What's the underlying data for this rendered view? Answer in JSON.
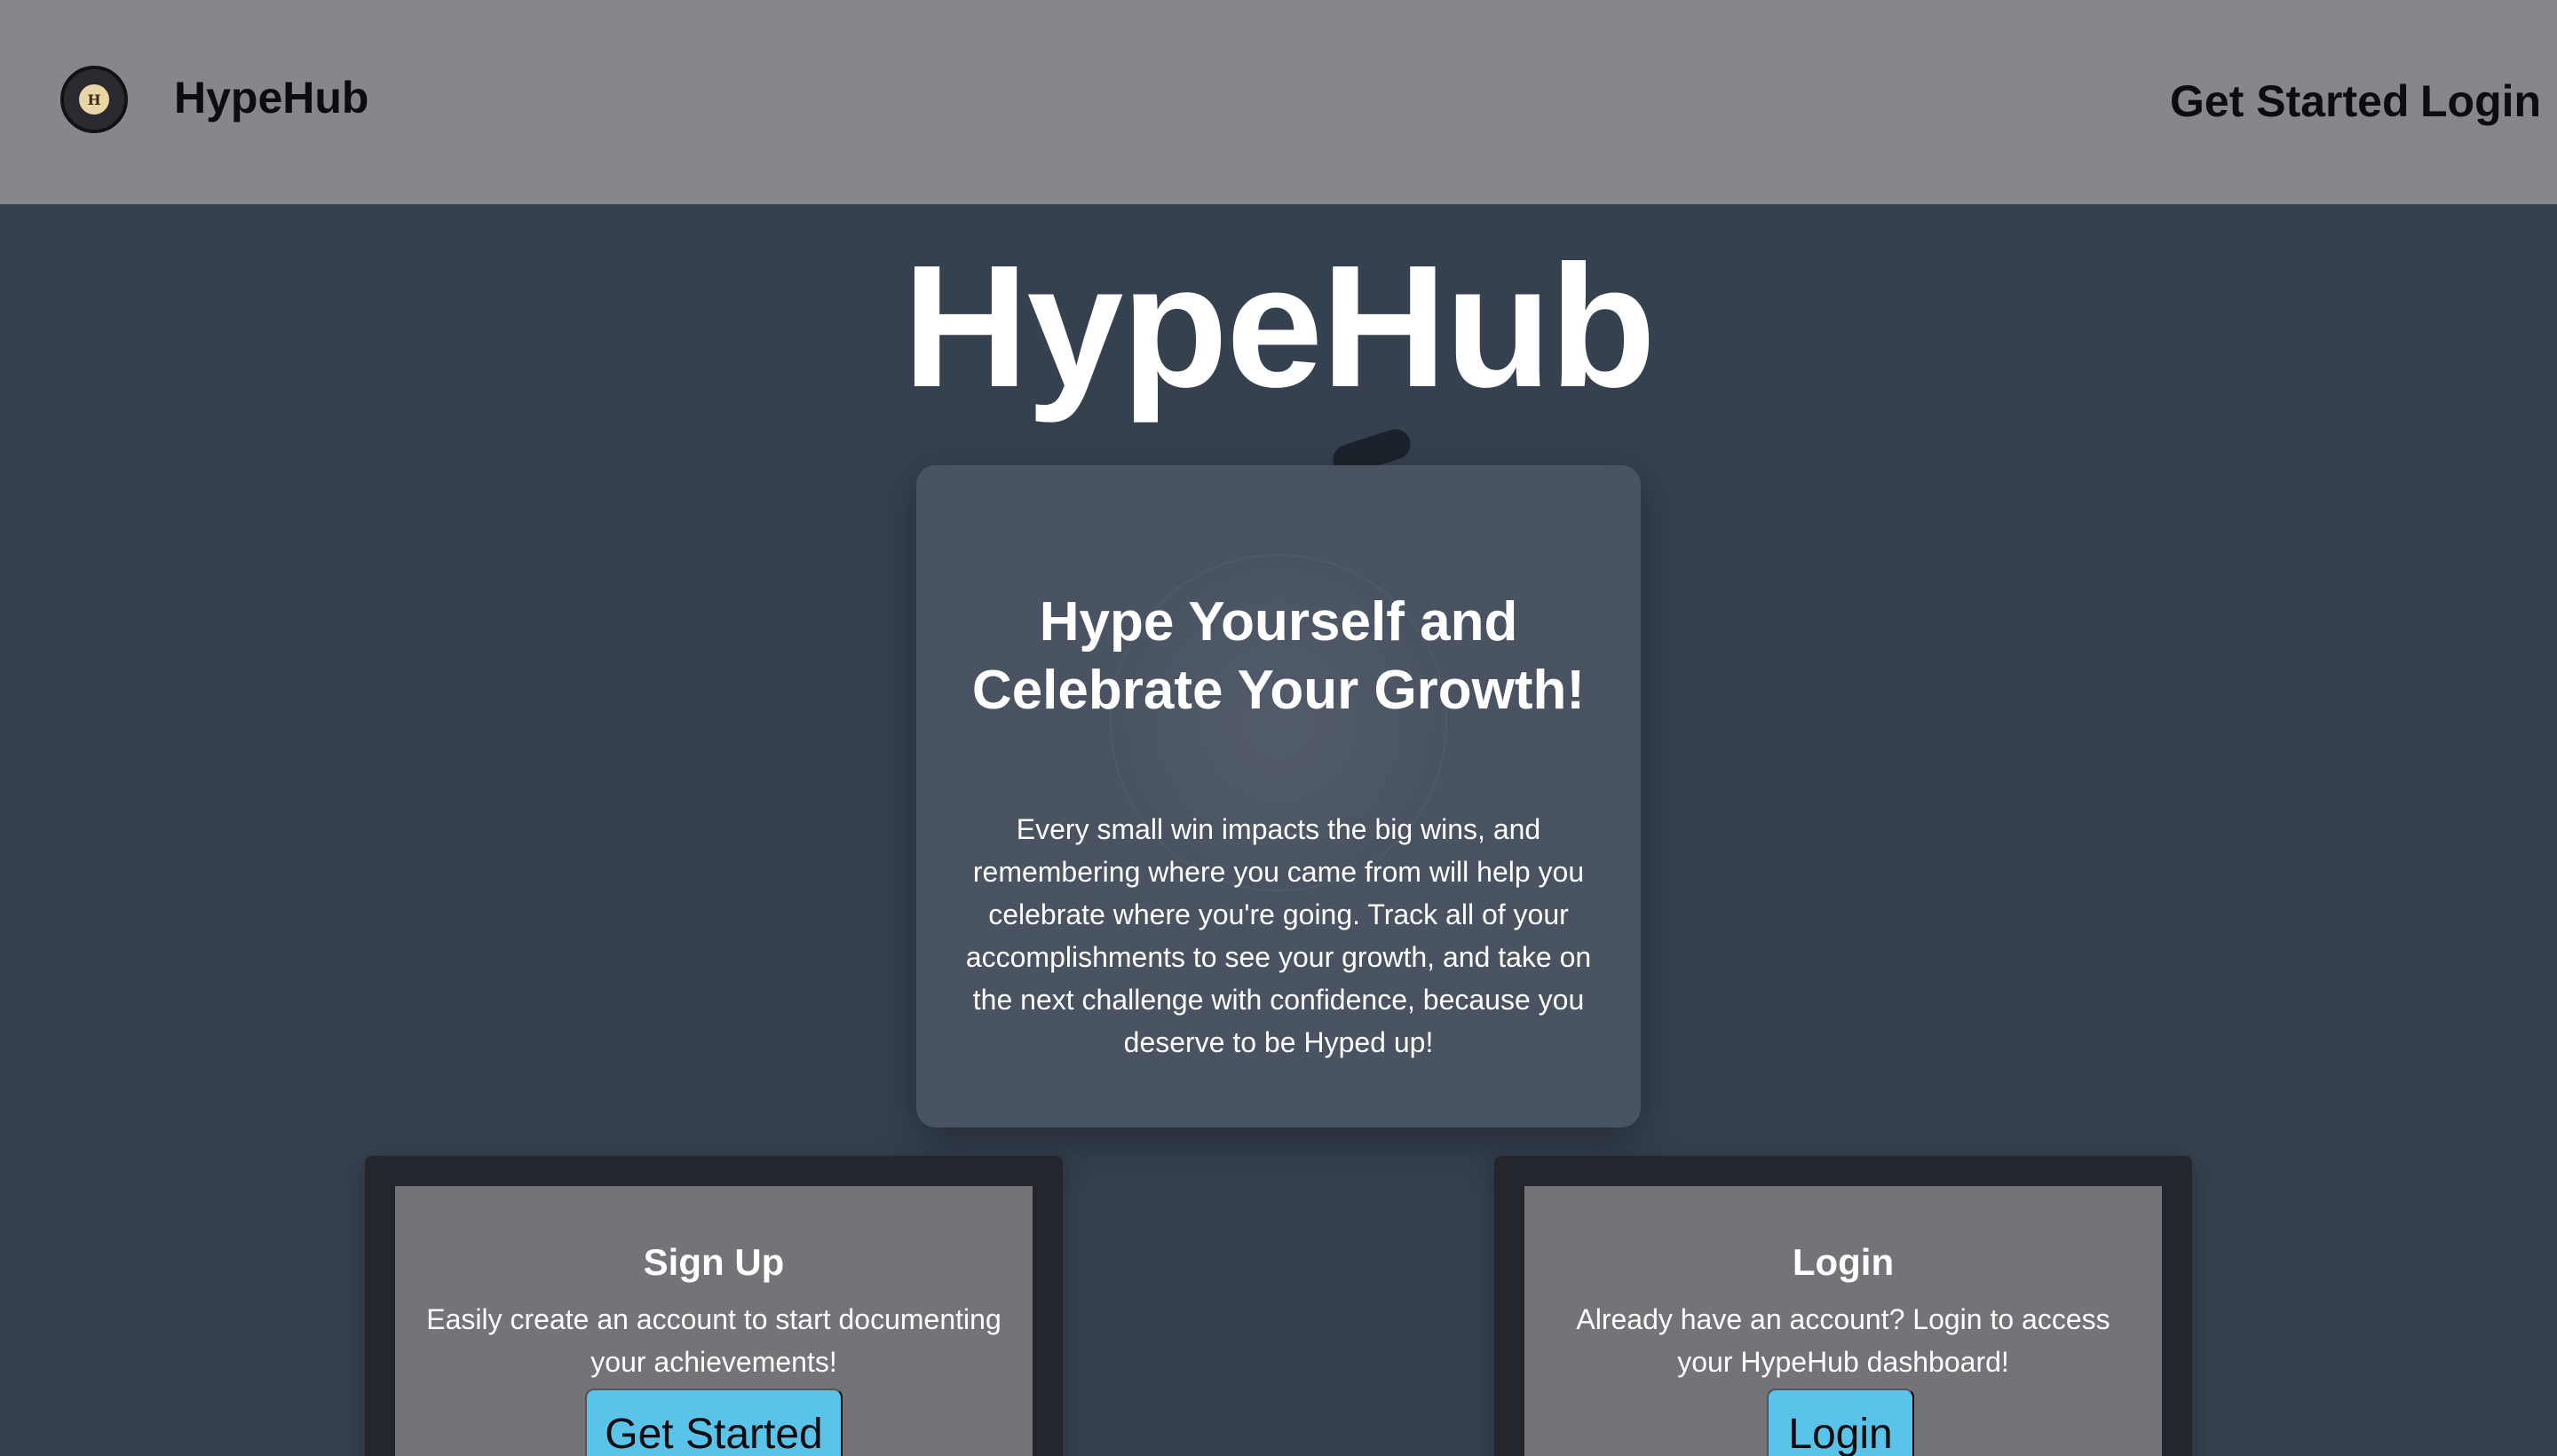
{
  "navbar": {
    "logo_icon": "hypehub-logo-icon",
    "logo_glyph": "H",
    "brand": "HypeHub",
    "links": {
      "get_started": "Get Started",
      "login": "Login"
    }
  },
  "hero": {
    "title": "HypeHub",
    "card": {
      "heading": "Hype Yourself and Celebrate Your Growth!",
      "body": "Every small win impacts the big wins, and remembering where you came from will help you celebrate where you're going. Track all of your accomplishments to see your growth, and take on the next challenge with confidence, because you deserve to be Hyped up!"
    }
  },
  "signup_card": {
    "title": "Sign Up",
    "description": "Easily create an account to start documenting your achievements!",
    "button": "Get Started"
  },
  "login_card": {
    "title": "Login",
    "description": "Already have an account? Login to access your HypeHub dashboard!",
    "button": "Login"
  },
  "colors": {
    "navbar_bg": "#86868d",
    "page_bg": "#364150",
    "hero_card_bg": "#4a5362",
    "action_card_border": "#23272d",
    "action_card_bg": "#737378",
    "button_bg": "#59c3ea"
  }
}
